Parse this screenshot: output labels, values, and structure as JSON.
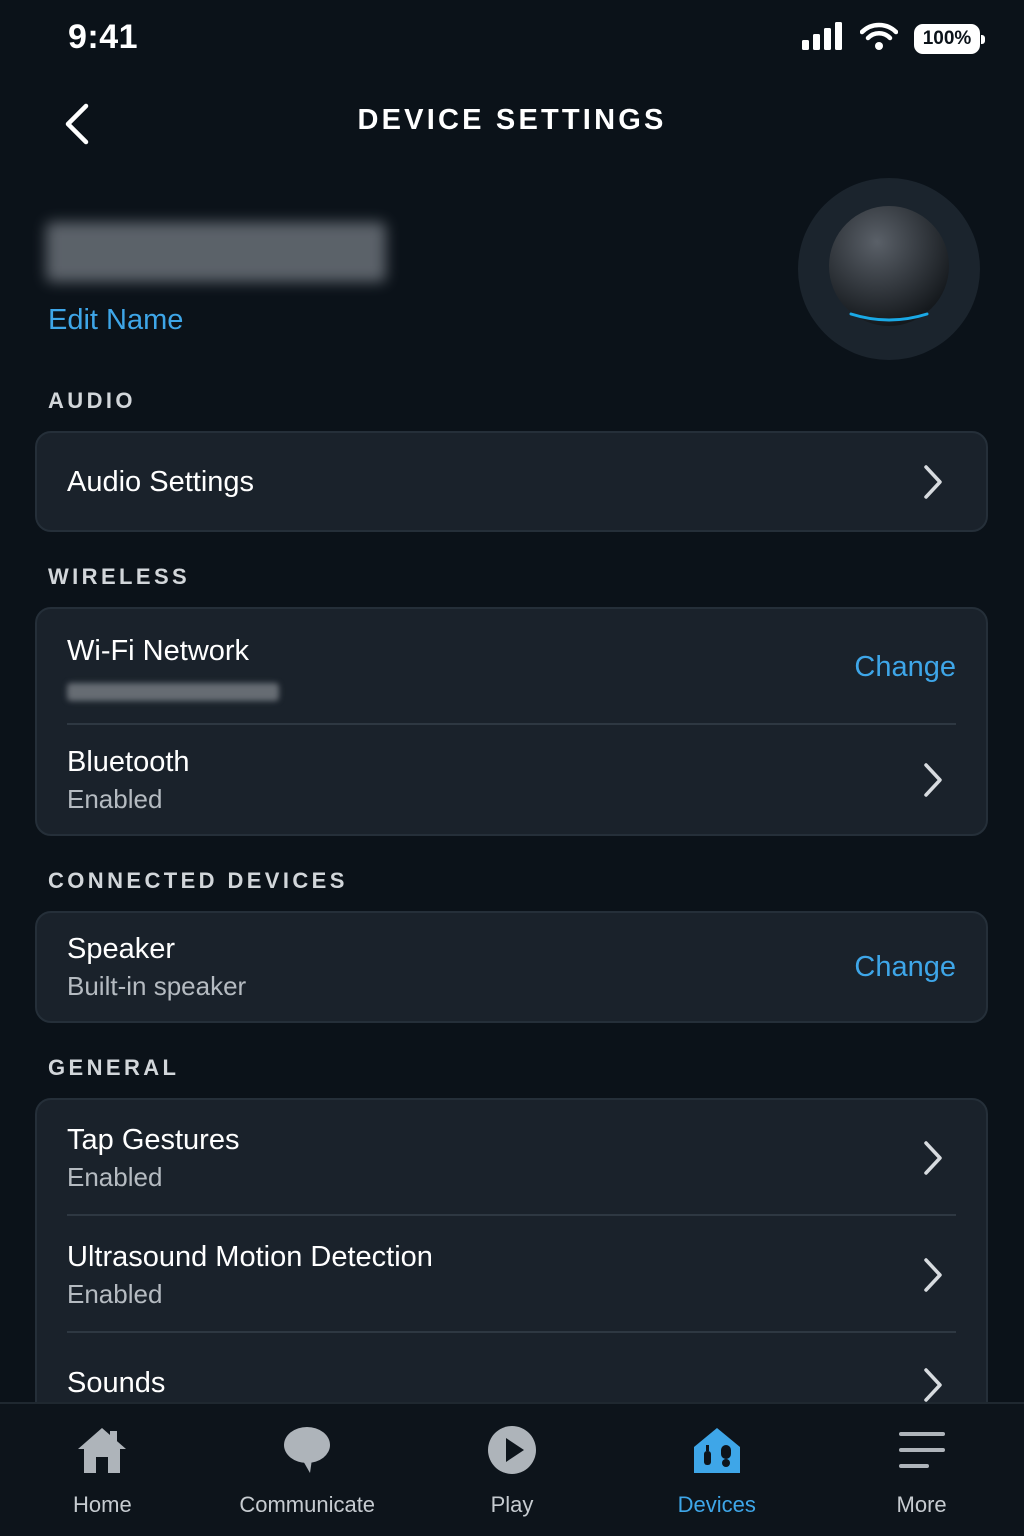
{
  "status_bar": {
    "time": "9:41",
    "battery": "100%"
  },
  "header": {
    "title": "DEVICE SETTINGS"
  },
  "device": {
    "edit_label": "Edit Name"
  },
  "sections": {
    "audio": {
      "label": "AUDIO",
      "audio_settings": "Audio Settings"
    },
    "wireless": {
      "label": "WIRELESS",
      "wifi_title": "Wi-Fi Network",
      "wifi_action": "Change",
      "bluetooth_title": "Bluetooth",
      "bluetooth_status": "Enabled"
    },
    "connected": {
      "label": "CONNECTED DEVICES",
      "speaker_title": "Speaker",
      "speaker_value": "Built-in speaker",
      "speaker_action": "Change"
    },
    "general": {
      "label": "GENERAL",
      "tap_title": "Tap Gestures",
      "tap_status": "Enabled",
      "ultrasound_title": "Ultrasound Motion Detection",
      "ultrasound_status": "Enabled",
      "sounds_title": "Sounds"
    }
  },
  "nav": {
    "home": "Home",
    "communicate": "Communicate",
    "play": "Play",
    "devices": "Devices",
    "more": "More",
    "active": "Devices"
  },
  "colors": {
    "background": "#0b1219",
    "card": "#1a222b",
    "accent": "#3ea6e8"
  }
}
